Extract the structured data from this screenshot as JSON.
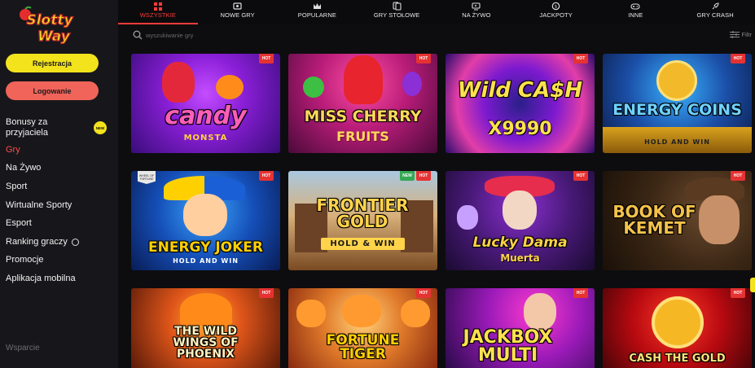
{
  "sidebar": {
    "logo_text": "Slotty Way",
    "register_label": "Rejestracja",
    "login_label": "Logowanie",
    "new_badge": "NEW",
    "items": [
      {
        "label": "Bonusy za przyjaciela"
      },
      {
        "label": "Gry"
      },
      {
        "label": "Na Żywo"
      },
      {
        "label": "Sport"
      },
      {
        "label": "Wirtualne Sporty"
      },
      {
        "label": "Esport"
      },
      {
        "label": "Ranking graczy"
      },
      {
        "label": "Promocje"
      },
      {
        "label": "Aplikacja mobilna"
      }
    ],
    "support_label": "Wsparcie"
  },
  "topnav": {
    "tabs": [
      {
        "label": "WSZYSTKIE",
        "icon": "grid-icon"
      },
      {
        "label": "NOWE GRY",
        "icon": "new-games-icon"
      },
      {
        "label": "POPULARNE",
        "icon": "crown-icon"
      },
      {
        "label": "GRY STOŁOWE",
        "icon": "cards-icon"
      },
      {
        "label": "NA ŻYWO",
        "icon": "live-icon"
      },
      {
        "label": "JACKPOTY",
        "icon": "jackpot-icon"
      },
      {
        "label": "INNE",
        "icon": "gamepad-icon"
      },
      {
        "label": "GRY CRASH",
        "icon": "rocket-icon"
      }
    ]
  },
  "search": {
    "placeholder": "wyszukiwanie gry",
    "filter_label": "Filtr"
  },
  "badges": {
    "hot": "HOT",
    "new": "NEW",
    "fortune": "WHEEL OF FORTUNE"
  },
  "games": [
    {
      "title": "candy",
      "subtitle": "MONSTA",
      "hot": true
    },
    {
      "title": "MISS CHERRY",
      "subtitle": "FRUITS",
      "hot": true
    },
    {
      "title": "Wild CA$H",
      "subtitle": "X9990",
      "hot": true
    },
    {
      "title": "ENERGY COINS",
      "subtitle": "HOLD AND WIN",
      "hot": true
    },
    {
      "title": "ENERGY JOKER",
      "subtitle": "HOLD AND WIN",
      "hot": true
    },
    {
      "title": "FRONTIER GOLD",
      "subtitle": "HOLD & WIN",
      "hot": true,
      "new": true
    },
    {
      "title": "Lucky Dama",
      "subtitle": "Muerta",
      "hot": true
    },
    {
      "title": "BOOK OF KEMET",
      "subtitle": "",
      "hot": true
    },
    {
      "title": "THE WILD WINGS OF PHOENIX",
      "subtitle": "",
      "hot": true
    },
    {
      "title": "FORTUNE TIGER",
      "subtitle": "",
      "hot": true
    },
    {
      "title": "JACKBOX MULTI",
      "subtitle": "",
      "hot": true
    },
    {
      "title": "CASH THE GOLD",
      "subtitle": "",
      "hot": true
    }
  ],
  "colors": {
    "accent_red": "#ff3b3b",
    "register_yellow": "#f3e31d",
    "login_coral": "#f0645a",
    "sidebar_bg": "#17171b"
  }
}
